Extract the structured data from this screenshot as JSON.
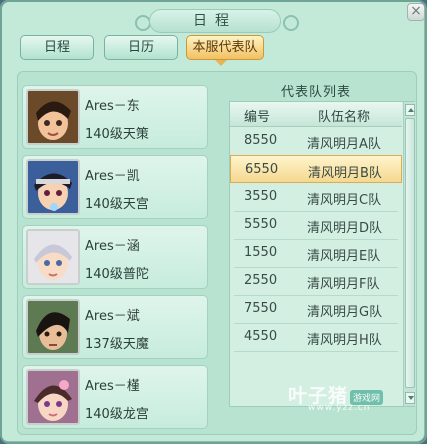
{
  "window": {
    "title": "日程",
    "close_glyph": "×"
  },
  "tabs": [
    {
      "label": "日程",
      "active": false
    },
    {
      "label": "日历",
      "active": false
    },
    {
      "label": "本服代表队",
      "active": true
    }
  ],
  "players": [
    {
      "name": "Ares－东",
      "level": "140级天策"
    },
    {
      "name": "Ares－凯",
      "level": "140级天宫"
    },
    {
      "name": "Ares－涵",
      "level": "140级普陀"
    },
    {
      "name": "Ares－斌",
      "level": "137级天魔"
    },
    {
      "name": "Ares－槿",
      "level": "140级龙宫"
    }
  ],
  "team_list": {
    "title": "代表队列表",
    "headers": [
      "编号",
      "队伍名称"
    ],
    "rows": [
      {
        "id": "8550",
        "name": "清风明月A队",
        "selected": false
      },
      {
        "id": "6550",
        "name": "清风明月B队",
        "selected": true
      },
      {
        "id": "3550",
        "name": "清风明月C队",
        "selected": false
      },
      {
        "id": "5550",
        "name": "清风明月D队",
        "selected": false
      },
      {
        "id": "1550",
        "name": "清风明月E队",
        "selected": false
      },
      {
        "id": "2550",
        "name": "清风明月F队",
        "selected": false
      },
      {
        "id": "7550",
        "name": "清风明月G队",
        "selected": false
      },
      {
        "id": "4550",
        "name": "清风明月H队",
        "selected": false
      }
    ]
  },
  "watermark": {
    "main": "叶子猪",
    "badge": "游戏网",
    "url": "www.yzz.cn"
  },
  "colors": {
    "accent": "#f2c062",
    "panel": "#c3ead9",
    "selected_row": "#f5d890"
  }
}
